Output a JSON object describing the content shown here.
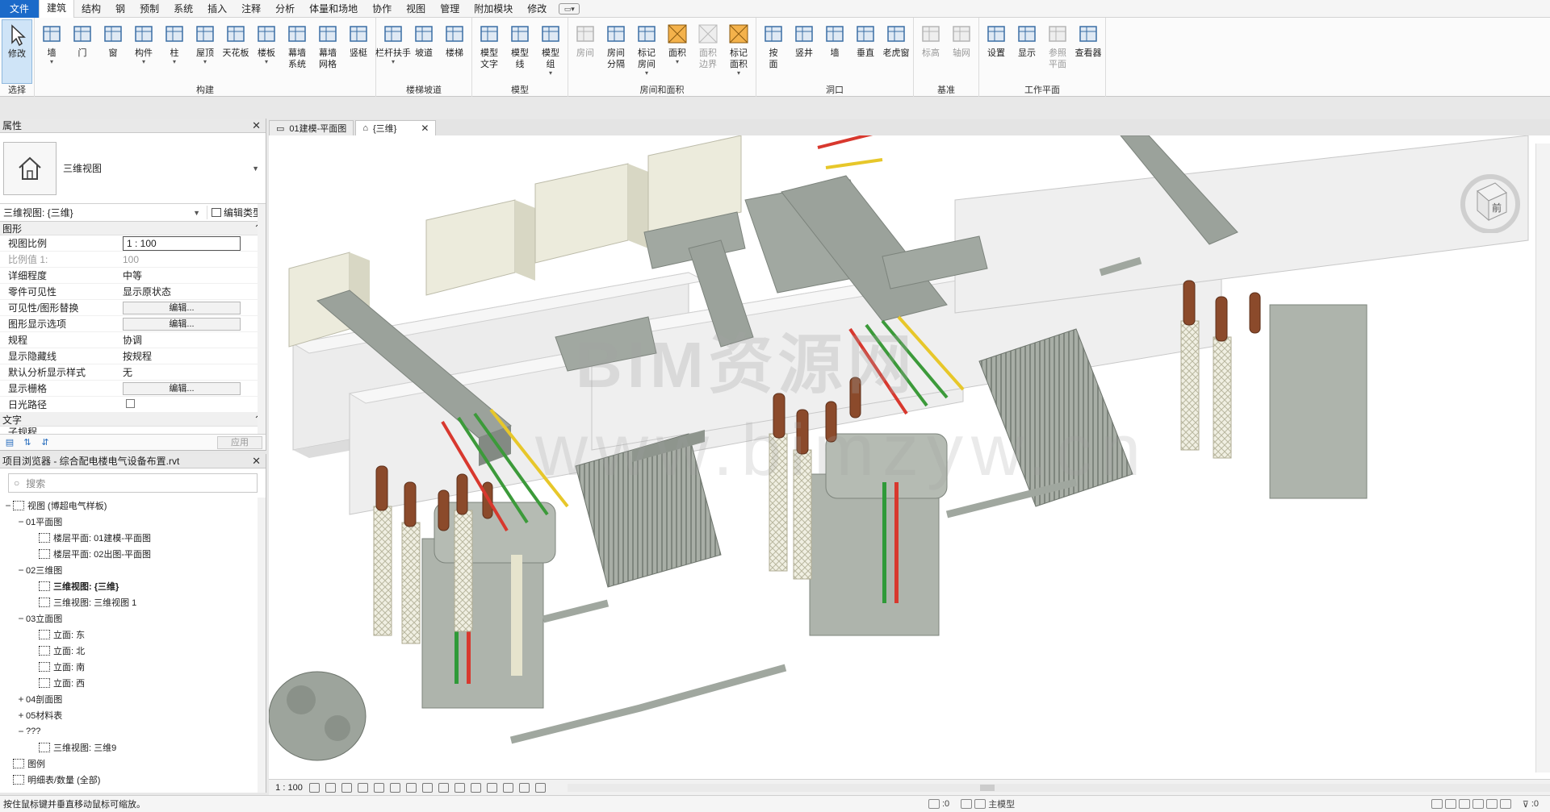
{
  "menu": {
    "items": [
      "文件",
      "建筑",
      "结构",
      "钢",
      "预制",
      "系统",
      "插入",
      "注释",
      "分析",
      "体量和场地",
      "协作",
      "视图",
      "管理",
      "附加模块",
      "修改"
    ],
    "active": "建筑"
  },
  "ribbon": {
    "groups": [
      {
        "title": "选择",
        "buttons": [
          {
            "label": "修改",
            "icon": "cursor-icon",
            "selected": true
          }
        ]
      },
      {
        "title": "构建",
        "buttons": [
          {
            "label": "墙",
            "icon": "wall-icon",
            "dropdown": true
          },
          {
            "label": "门",
            "icon": "door-icon"
          },
          {
            "label": "窗",
            "icon": "window-icon"
          },
          {
            "label": "构件",
            "icon": "component-icon",
            "dropdown": true
          },
          {
            "label": "柱",
            "icon": "column-icon",
            "dropdown": true
          },
          {
            "label": "屋顶",
            "icon": "roof-icon",
            "dropdown": true
          },
          {
            "label": "天花板",
            "icon": "ceiling-icon"
          },
          {
            "label": "楼板",
            "icon": "floor-icon",
            "dropdown": true
          },
          {
            "label": "幕墙\n系统",
            "icon": "curtain-system-icon"
          },
          {
            "label": "幕墙\n网格",
            "icon": "curtain-grid-icon"
          },
          {
            "label": "竖梃",
            "icon": "mullion-icon"
          }
        ]
      },
      {
        "title": "楼梯坡道",
        "buttons": [
          {
            "label": "栏杆扶手",
            "icon": "railing-icon",
            "dropdown": true
          },
          {
            "label": "坡道",
            "icon": "ramp-icon"
          },
          {
            "label": "楼梯",
            "icon": "stair-icon"
          }
        ]
      },
      {
        "title": "模型",
        "buttons": [
          {
            "label": "模型\n文字",
            "icon": "model-text-icon"
          },
          {
            "label": "模型\n线",
            "icon": "model-line-icon"
          },
          {
            "label": "模型\n组",
            "icon": "model-group-icon",
            "dropdown": true
          }
        ]
      },
      {
        "title": "房间和面积",
        "buttons": [
          {
            "label": "房间",
            "icon": "room-icon",
            "disabled": true
          },
          {
            "label": "房间\n分隔",
            "icon": "room-separator-icon"
          },
          {
            "label": "标记\n房间",
            "icon": "tag-room-icon",
            "dropdown": true
          },
          {
            "label": "面积",
            "icon": "area-icon",
            "dropdown": true
          },
          {
            "label": "面积\n边界",
            "icon": "area-boundary-icon",
            "disabled": true
          },
          {
            "label": "标记\n面积",
            "icon": "tag-area-icon",
            "dropdown": true
          }
        ]
      },
      {
        "title": "洞口",
        "buttons": [
          {
            "label": "按\n面",
            "icon": "by-face-icon"
          },
          {
            "label": "竖井",
            "icon": "shaft-icon"
          },
          {
            "label": "墙",
            "icon": "wall-opening-icon"
          },
          {
            "label": "垂直",
            "icon": "vertical-icon"
          },
          {
            "label": "老虎窗",
            "icon": "dormer-icon"
          }
        ]
      },
      {
        "title": "基准",
        "buttons": [
          {
            "label": "标高",
            "icon": "level-icon",
            "disabled": true
          },
          {
            "label": "轴网",
            "icon": "grid-icon",
            "disabled": true
          }
        ]
      },
      {
        "title": "工作平面",
        "buttons": [
          {
            "label": "设置",
            "icon": "set-icon"
          },
          {
            "label": "显示",
            "icon": "show-icon"
          },
          {
            "label": "参照\n平面",
            "icon": "ref-plane-icon",
            "disabled": true
          },
          {
            "label": "查看器",
            "icon": "viewer-icon"
          }
        ]
      }
    ]
  },
  "properties": {
    "title": "属性",
    "type_name": "三维视图",
    "instance_selector": "三维视图: {三维}",
    "edit_type": "编辑类型",
    "section_graphics": "图形",
    "rows": [
      {
        "key": "视图比例",
        "value": "1 : 100",
        "kind": "input"
      },
      {
        "key": "比例值 1:",
        "value": "100",
        "kind": "text",
        "dim": true
      },
      {
        "key": "详细程度",
        "value": "中等",
        "kind": "text"
      },
      {
        "key": "零件可见性",
        "value": "显示原状态",
        "kind": "text"
      },
      {
        "key": "可见性/图形替换",
        "value": "编辑...",
        "kind": "button"
      },
      {
        "key": "图形显示选项",
        "value": "编辑...",
        "kind": "button"
      },
      {
        "key": "规程",
        "value": "协调",
        "kind": "text"
      },
      {
        "key": "显示隐藏线",
        "value": "按规程",
        "kind": "text"
      },
      {
        "key": "默认分析显示样式",
        "value": "无",
        "kind": "text"
      },
      {
        "key": "显示栅格",
        "value": "编辑...",
        "kind": "button"
      },
      {
        "key": "日光路径",
        "value": "",
        "kind": "checkbox"
      }
    ],
    "section_text": "文字",
    "sub_row": "子规程",
    "apply": "应用"
  },
  "browser": {
    "title": "项目浏览器 - 综合配电楼电气设备布置.rvt",
    "search_placeholder": "搜索",
    "tree": [
      {
        "label": "视图 (博超电气样板)",
        "level": 0,
        "toggle": "−",
        "icon": "views-icon"
      },
      {
        "label": "01平面图",
        "level": 1,
        "toggle": "−"
      },
      {
        "label": "楼层平面: 01建模-平面图",
        "level": 2,
        "icon": "plan-icon"
      },
      {
        "label": "楼层平面: 02出图-平面图",
        "level": 2,
        "icon": "plan-icon"
      },
      {
        "label": "02三维图",
        "level": 1,
        "toggle": "−"
      },
      {
        "label": "三维视图: {三维}",
        "level": 2,
        "icon": "3d-icon",
        "bold": true
      },
      {
        "label": "三维视图: 三维视图 1",
        "level": 2,
        "icon": "3d-icon"
      },
      {
        "label": "03立面图",
        "level": 1,
        "toggle": "−"
      },
      {
        "label": "立面: 东",
        "level": 2,
        "icon": "elevation-icon"
      },
      {
        "label": "立面: 北",
        "level": 2,
        "icon": "elevation-icon"
      },
      {
        "label": "立面: 南",
        "level": 2,
        "icon": "elevation-icon"
      },
      {
        "label": "立面: 西",
        "level": 2,
        "icon": "elevation-icon"
      },
      {
        "label": "04剖面图",
        "level": 1,
        "toggle": "+"
      },
      {
        "label": "05材料表",
        "level": 1,
        "toggle": "+"
      },
      {
        "label": "???",
        "level": 1,
        "toggle": "−"
      },
      {
        "label": "三维视图: 三维9",
        "level": 2,
        "icon": "3d-icon"
      },
      {
        "label": "图例",
        "level": 0,
        "icon": "legend-icon"
      },
      {
        "label": "明细表/数量 (全部)",
        "level": 0,
        "icon": "schedule-icon"
      }
    ]
  },
  "tabs": [
    {
      "label": "01建模-平面图",
      "active": false
    },
    {
      "label": "{三维}",
      "active": true
    }
  ],
  "viewport": {
    "watermark_line1": "BIM资源网",
    "watermark_line2": "www.bimzyw.cn",
    "viewcube_label": "前"
  },
  "view_control": {
    "scale": "1 : 100"
  },
  "status": {
    "message": "按住鼠标键并垂直移动鼠标可缩放。",
    "workset": ":0",
    "model": "主模型",
    "filter": ":0"
  },
  "colors": {
    "accent": "#1b6ac9",
    "equipment": "#b7bdb5",
    "duct": "#9aa19a",
    "bushing": "#8b4a2b",
    "busbar_yellow": "#e7c72a",
    "busbar_green": "#3c9a3a",
    "busbar_red": "#d8382e"
  }
}
